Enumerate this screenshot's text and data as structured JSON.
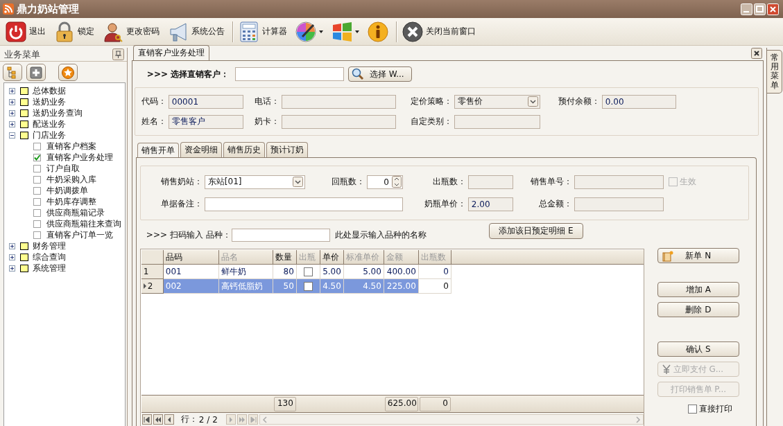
{
  "window": {
    "title": "鼎力奶站管理"
  },
  "toolbar": {
    "groups": [
      {
        "items": [
          {
            "kind": "power",
            "label": "退出",
            "dropdown": false
          },
          {
            "kind": "lock",
            "label": "锁定",
            "dropdown": false
          },
          {
            "kind": "user",
            "label": "更改密码",
            "dropdown": false
          },
          {
            "kind": "megaphone",
            "label": "系统公告",
            "dropdown": false
          }
        ]
      },
      {
        "items": [
          {
            "kind": "calculator",
            "label": "计算器",
            "dropdown": false
          },
          {
            "kind": "palette",
            "dropdown": true
          },
          {
            "kind": "windows",
            "dropdown": true
          },
          {
            "kind": "info",
            "dropdown": false
          }
        ]
      },
      {
        "items": [
          {
            "kind": "close",
            "label": "关闭当前窗口",
            "dropdown": false
          }
        ]
      }
    ]
  },
  "sidebar": {
    "title": "业务菜单",
    "tools": [
      {
        "kind": "tree"
      },
      {
        "kind": "plus"
      },
      {
        "kind": "star"
      }
    ],
    "items": [
      {
        "label": "总体数据",
        "expanded": false
      },
      {
        "label": "送奶业务",
        "expanded": false
      },
      {
        "label": "送奶业务查询",
        "expanded": false
      },
      {
        "label": "配送业务",
        "expanded": false
      },
      {
        "label": "门店业务",
        "expanded": true,
        "children": [
          {
            "label": "直销客户档案",
            "checked": false
          },
          {
            "label": "直销客户业务处理",
            "checked": true
          },
          {
            "label": "订户自取",
            "checked": false
          },
          {
            "label": "牛奶采购入库",
            "checked": false
          },
          {
            "label": "牛奶调拨单",
            "checked": false
          },
          {
            "label": "牛奶库存调整",
            "checked": false
          },
          {
            "label": "供应商瓶箱记录",
            "checked": false
          },
          {
            "label": "供应商瓶箱往来查询",
            "checked": false
          },
          {
            "label": "直销客户订单一览",
            "checked": false
          }
        ]
      },
      {
        "label": "财务管理",
        "expanded": false
      },
      {
        "label": "综合查询",
        "expanded": false
      },
      {
        "label": "系统管理",
        "expanded": false
      }
    ]
  },
  "document_tab": {
    "label": "直销客户业务处理",
    "selected": true
  },
  "customer_select": {
    "label": ">>> 选择直销客户：",
    "button": "选择 W..."
  },
  "info": {
    "rows": [
      [
        {
          "label": "代码：",
          "value": "00001",
          "kind": "text",
          "readonly": true
        },
        {
          "label": "电话：",
          "kind": "text",
          "readonly": true
        },
        {
          "label": "定价策略：",
          "value": "零售价",
          "kind": "select",
          "readonly": true
        },
        {
          "label": "预付余额：",
          "value": "0.00",
          "kind": "text",
          "readonly": true
        }
      ],
      [
        {
          "label": "姓名：",
          "value": "零售客户",
          "kind": "text",
          "readonly": true
        },
        {
          "label": "奶卡：",
          "kind": "text",
          "readonly": true
        },
        {
          "label": "自定类别：",
          "kind": "text",
          "readonly": true
        }
      ]
    ]
  },
  "tabs": [
    {
      "label": "销售开单",
      "selected": true
    },
    {
      "label": "资金明细",
      "selected": false
    },
    {
      "label": "销售历史",
      "selected": false
    },
    {
      "label": "预计订奶",
      "selected": false
    }
  ],
  "sale_form": {
    "fields": [
      {
        "label": "销售奶站：",
        "value": "东站[01]",
        "kind": "select",
        "readonly": false
      },
      {
        "label": "回瓶数：",
        "value": "0",
        "kind": "spinner",
        "readonly": false
      },
      {
        "label": "出瓶数：",
        "kind": "text",
        "readonly": true
      },
      {
        "label": "销售单号：",
        "kind": "text",
        "readonly": true
      },
      {
        "label": "生效",
        "kind": "check",
        "checked": false,
        "readonly": true
      },
      {
        "label": "单据备注：",
        "kind": "memo",
        "readonly": false
      },
      {
        "label": "奶瓶单价：",
        "value": "2.00",
        "kind": "text",
        "readonly": true
      },
      {
        "label": "总金额：",
        "kind": "text",
        "readonly": true
      }
    ]
  },
  "scan": {
    "label": ">>> 扫码输入 品种：",
    "hint": "此处显示输入品种的名称",
    "button": "添加该日预定明细 E"
  },
  "grid": {
    "columns": [
      {
        "label": "品码",
        "kind": "text",
        "readonly": false,
        "current": false
      },
      {
        "label": "品名",
        "kind": "text",
        "readonly": true,
        "current": false
      },
      {
        "label": "数量",
        "kind": "number",
        "readonly": false,
        "current": false,
        "total": "130"
      },
      {
        "label": "出瓶",
        "kind": "check",
        "readonly": true,
        "current": false
      },
      {
        "label": "单价",
        "kind": "number",
        "readonly": false,
        "current": false
      },
      {
        "label": "标准单价",
        "kind": "number",
        "readonly": true,
        "current": false
      },
      {
        "label": "金额",
        "kind": "number",
        "readonly": true,
        "current": false,
        "total": "625.00"
      },
      {
        "label": "出瓶数",
        "kind": "number",
        "readonly": true,
        "current": true,
        "total": "0"
      }
    ],
    "rows": [
      {
        "number": "1",
        "selected": false,
        "cells": [
          {
            "text": "001"
          },
          {
            "text": "鲜牛奶"
          },
          {
            "text": "80"
          },
          {
            "checked": false
          },
          {
            "text": "5.00"
          },
          {
            "text": "5.00"
          },
          {
            "text": "400.00"
          },
          {
            "text": "0"
          }
        ]
      },
      {
        "number": "2",
        "selected": true,
        "cells": [
          {
            "text": "002"
          },
          {
            "text": "高钙低脂奶"
          },
          {
            "text": "50"
          },
          {
            "checked": false
          },
          {
            "text": "4.50"
          },
          {
            "text": "4.50"
          },
          {
            "text": "225.00"
          },
          {
            "text": "0"
          }
        ]
      }
    ],
    "navigator": {
      "label": "行：",
      "position": "2 / 2"
    }
  },
  "actions": [
    {
      "label": "新单 N",
      "kind": "new",
      "disabled": false
    },
    {
      "label": "增加 A",
      "kind": "plain",
      "disabled": false
    },
    {
      "label": "删除 D",
      "kind": "plain",
      "disabled": false
    },
    {
      "label": "确认 S",
      "kind": "plain",
      "disabled": false
    },
    {
      "label": "立即支付 G...",
      "kind": "pay",
      "disabled": true
    },
    {
      "label": "打印销售单 P...",
      "kind": "plain",
      "disabled": true
    }
  ],
  "direct_print": {
    "label": "直接打印",
    "checked": false
  },
  "side_tab": {
    "label": "常用菜单"
  }
}
